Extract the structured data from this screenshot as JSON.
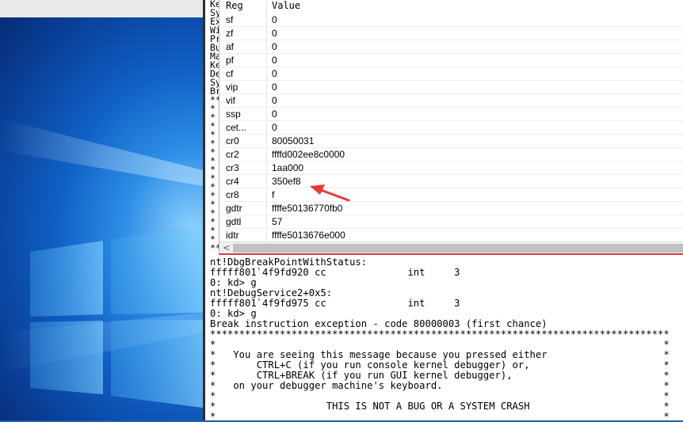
{
  "registers_window": {
    "columns": {
      "reg": "Reg",
      "value": "Value"
    },
    "rows": [
      {
        "reg": "sf",
        "value": "0"
      },
      {
        "reg": "zf",
        "value": "0"
      },
      {
        "reg": "af",
        "value": "0"
      },
      {
        "reg": "pf",
        "value": "0"
      },
      {
        "reg": "cf",
        "value": "0"
      },
      {
        "reg": "vip",
        "value": "0"
      },
      {
        "reg": "vif",
        "value": "0"
      },
      {
        "reg": "ssp",
        "value": "0"
      },
      {
        "reg": "cet...",
        "value": "0"
      },
      {
        "reg": "cr0",
        "value": "80050031"
      },
      {
        "reg": "cr2",
        "value": "ffffd002ee8c0000"
      },
      {
        "reg": "cr3",
        "value": "1aa000"
      },
      {
        "reg": "cr4",
        "value": "350ef8"
      },
      {
        "reg": "cr8",
        "value": "f"
      },
      {
        "reg": "gdtr",
        "value": "ffffe50136770fb0"
      },
      {
        "reg": "gdtl",
        "value": "57"
      },
      {
        "reg": "idtr",
        "value": "ffffe5013676e000"
      }
    ],
    "scroll_left_arrow": "<",
    "annotation_color": "#e53935"
  },
  "command_window": {
    "left_column": "Ke\nSy\nEx\nWi\nPr\nBu\nMa\nKe\nDe\nSy\nBr\n**\n*\n*\n*\n*\n*\n*\n*\n*\n*\n*\n*\n*\n*\n*\n*\n*\n**",
    "output": "nt!DbgBreakPointWithStatus:\nfffff801`4f9fd920 cc              int     3\n0: kd> g\nnt!DebugService2+0x5:\nfffff801`4f9fd975 cc              int     3\n0: kd> g\nBreak instruction exception - code 80000003 (first chance)\n*******************************************************************************\n*                                                                             *\n*   You are seeing this message because you pressed either                    *\n*       CTRL+C (if you run console kernel debugger) or,                       *\n*       CTRL+BREAK (if you run GUI kernel debugger),                          *\n*   on your debugger machine's keyboard.                                      *\n*                                                                             *\n*                   THIS IS NOT A BUG OR A SYSTEM CRASH                       *\n*                                                                             *"
  }
}
